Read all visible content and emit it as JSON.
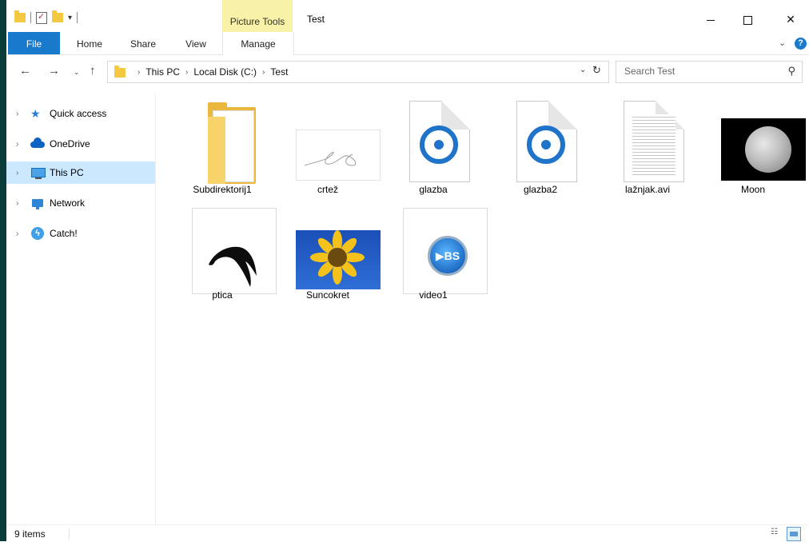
{
  "window": {
    "title": "Test",
    "context_tab": "Picture Tools",
    "controls": {
      "minimize": "—",
      "maximize": "☐",
      "close": "✕"
    }
  },
  "quick_access_toolbar": {
    "dropdown": "▾"
  },
  "ribbon": {
    "tabs": [
      {
        "label": "File"
      },
      {
        "label": "Home"
      },
      {
        "label": "Share"
      },
      {
        "label": "View"
      },
      {
        "label": "Manage"
      }
    ],
    "collapse_icon": "chevron-down-icon",
    "help_label": "?"
  },
  "navigation": {
    "back": "←",
    "forward": "→",
    "recent": "⌄",
    "up": "↑",
    "breadcrumbs": [
      "This PC",
      "Local Disk (C:)",
      "Test"
    ],
    "refresh": "↻",
    "search_placeholder": "Search Test",
    "search_icon": "⚲"
  },
  "sidebar": {
    "items": [
      {
        "label": "Quick access",
        "icon": "star-icon"
      },
      {
        "label": "OneDrive",
        "icon": "cloud-icon"
      },
      {
        "label": "This PC",
        "icon": "computer-icon",
        "selected": true
      },
      {
        "label": "Network",
        "icon": "network-icon"
      },
      {
        "label": "Catch!",
        "icon": "catch-icon"
      }
    ]
  },
  "files": [
    {
      "name": "Subdirektorij1",
      "type": "folder"
    },
    {
      "name": "crtež",
      "type": "image-signature"
    },
    {
      "name": "glazba",
      "type": "audio"
    },
    {
      "name": "glazba2",
      "type": "audio"
    },
    {
      "name": "lažnjak.avi",
      "type": "text"
    },
    {
      "name": "Moon",
      "type": "image-moon"
    },
    {
      "name": "ptica",
      "type": "image-bird"
    },
    {
      "name": "Suncokret",
      "type": "image-sunflower"
    },
    {
      "name": "video1",
      "type": "video"
    }
  ],
  "status": {
    "item_count": "9 items"
  },
  "colors": {
    "accent": "#1979ca",
    "context_tab": "#f8f1a8",
    "selection": "#cce8ff",
    "folder": "#e9b83c"
  }
}
